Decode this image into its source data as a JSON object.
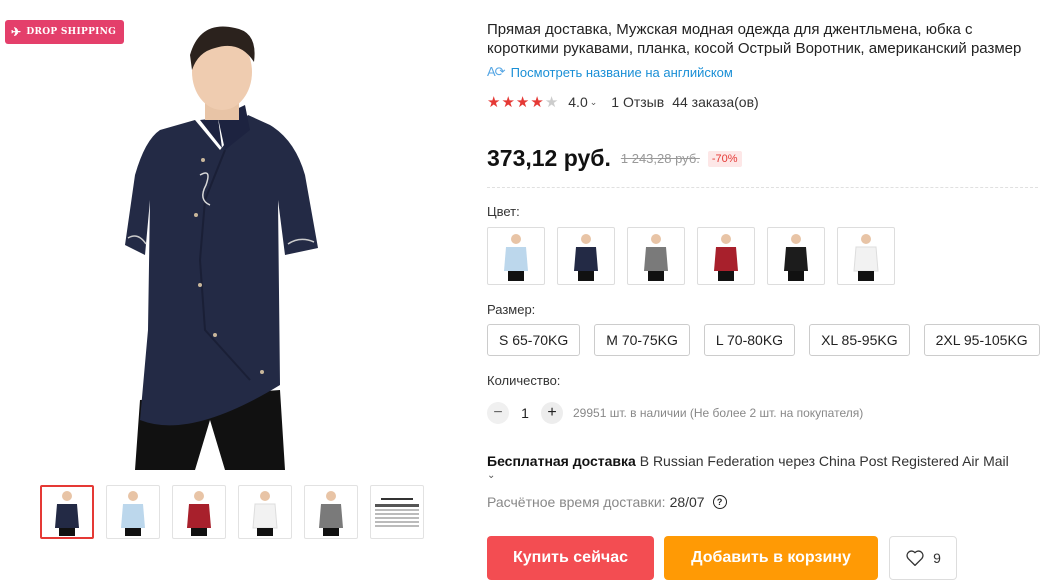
{
  "gallery": {
    "badge": "DROP SHIPPING",
    "main_image_icon": "man-navy-shirt-photo",
    "thumbnails": [
      {
        "icon": "navy-shirt-thumb",
        "color": "#232a45"
      },
      {
        "icon": "light-blue-shirt-thumb",
        "color": "#bcd7ec"
      },
      {
        "icon": "red-shirt-thumb",
        "color": "#a8202c"
      },
      {
        "icon": "white-shirt-thumb",
        "color": "#f2f2f2"
      },
      {
        "icon": "grey-shirt-thumb",
        "color": "#7a7a7a"
      },
      {
        "icon": "product-parameters-thumb",
        "color": "#ffffff"
      }
    ]
  },
  "product": {
    "title": "Прямая доставка, Мужская модная одежда для джентльмена, юбка с короткими рукавами, планка, косой Острый Воротник, американский размер",
    "translate_link": "Посмотреть название на английском",
    "rating": "4.0",
    "rating_stars": 4,
    "reviews": "1 Отзыв",
    "orders": "44 заказа(ов)",
    "price": "373,12 руб.",
    "old_price": "1 243,28 руб.",
    "discount": "-70%"
  },
  "color": {
    "label": "Цвет:",
    "options": [
      {
        "icon": "light-blue-shirt-swatch",
        "color": "#bcd7ec"
      },
      {
        "icon": "navy-shirt-swatch",
        "color": "#232a45"
      },
      {
        "icon": "grey-shirt-swatch",
        "color": "#7a7a7a"
      },
      {
        "icon": "red-shirt-swatch",
        "color": "#a8202c"
      },
      {
        "icon": "black-shirt-swatch",
        "color": "#1c1c1c"
      },
      {
        "icon": "white-shirt-swatch",
        "color": "#f2f2f2"
      }
    ]
  },
  "size": {
    "label": "Размер:",
    "options": [
      "S 65-70KG",
      "M 70-75KG",
      "L 70-80KG",
      "XL 85-95KG",
      "2XL 95-105KG"
    ]
  },
  "quantity": {
    "label": "Количество:",
    "value": "1",
    "stock": "29951 шт. в наличии (Не более 2 шт. на покупателя)"
  },
  "shipping": {
    "free": "Бесплатная доставка",
    "route": " В Russian Federation через China Post Registered Air Mail",
    "eta_label": "Расчётное время доставки:",
    "eta_date": "28/07"
  },
  "actions": {
    "buy": "Купить сейчас",
    "cart": "Добавить в корзину",
    "wishlist_count": "9"
  },
  "colors": {
    "accent_red": "#f34d52",
    "accent_orange": "#ff9a05",
    "link_blue": "#1a8fd6",
    "badge_pink": "#e43f6b"
  }
}
